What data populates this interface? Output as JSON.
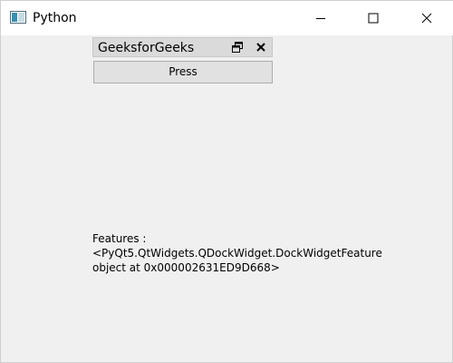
{
  "window": {
    "title": "Python",
    "icon": "python-app-icon",
    "controls": {
      "minimize_icon": "minimize-icon",
      "maximize_icon": "maximize-icon",
      "close_icon": "close-icon"
    }
  },
  "dock": {
    "title": "GeeksforGeeks",
    "float_icon": "float-restore-icon",
    "close_icon": "close-icon"
  },
  "main": {
    "button_label": "Press",
    "features_text": "Features :\n<PyQt5.QtWidgets.QDockWidget.DockWidgetFeature\nobject at 0x000002631ED9D668>"
  },
  "colors": {
    "background": "#f0f0f0",
    "titlebar": "#ffffff",
    "dock_title_bg": "#dadada",
    "button_bg": "#e1e1e1",
    "button_border": "#adadad"
  }
}
